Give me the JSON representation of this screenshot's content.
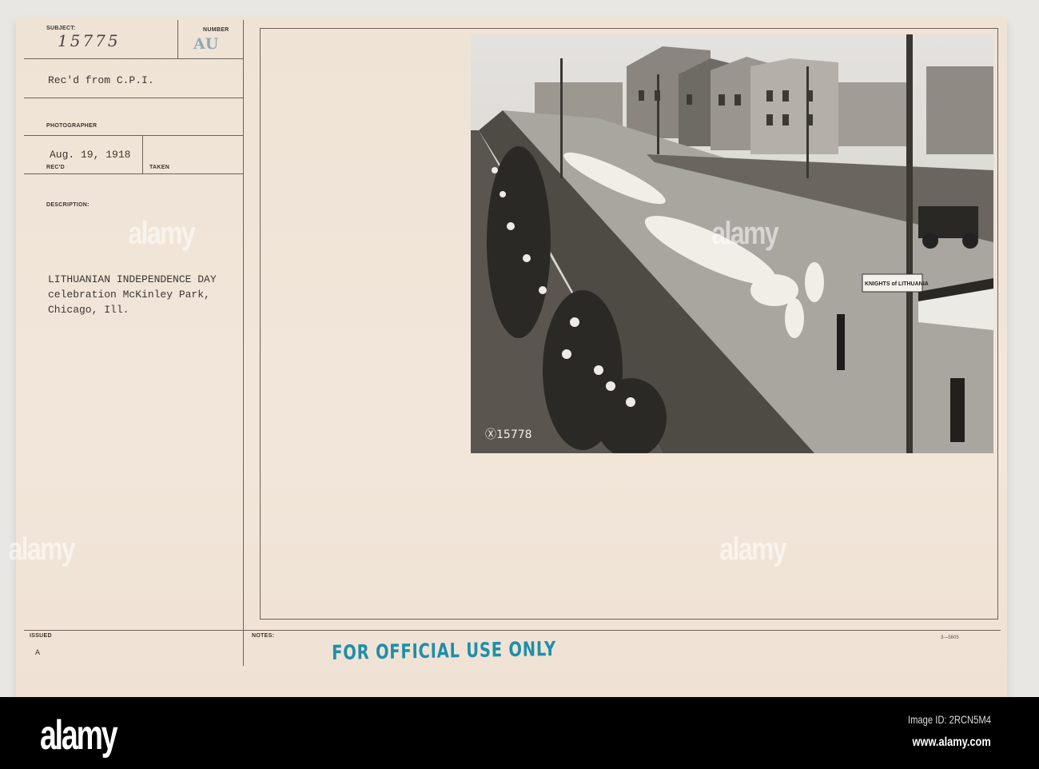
{
  "card": {
    "subject_label": "SUBJECT:",
    "subject_value": "15775",
    "number_label": "NUMBER",
    "number_value": "AU",
    "received_from": "Rec'd from C.P.I.",
    "photographer_label": "PHOTOGRAPHER",
    "date": "Aug. 19, 1918",
    "recd_label": "REC'D",
    "taken_label": "TAKEN",
    "description_label": "DESCRIPTION:",
    "description_lines": [
      "LITHUANIAN INDEPENDENCE DAY",
      "celebration McKinley Park,",
      "Chicago, Ill."
    ],
    "issued_label": "ISSUED",
    "issued_value": "A",
    "notes_label": "NOTES:",
    "stamp": "FOR OFFICIAL USE ONLY",
    "form_code": "3—5605"
  },
  "photo": {
    "negative_number": "Ⓧ15778",
    "banner_text": "KNIGHTS of LITHUANIA"
  },
  "footer": {
    "logo": "alamy",
    "image_id": "Image ID: 2RCN5M4",
    "url": "www.alamy.com"
  },
  "watermark": "alamy",
  "colors": {
    "paper": "#f0e4d7",
    "stamp": "#1f8ea8",
    "footer": "#000000"
  }
}
